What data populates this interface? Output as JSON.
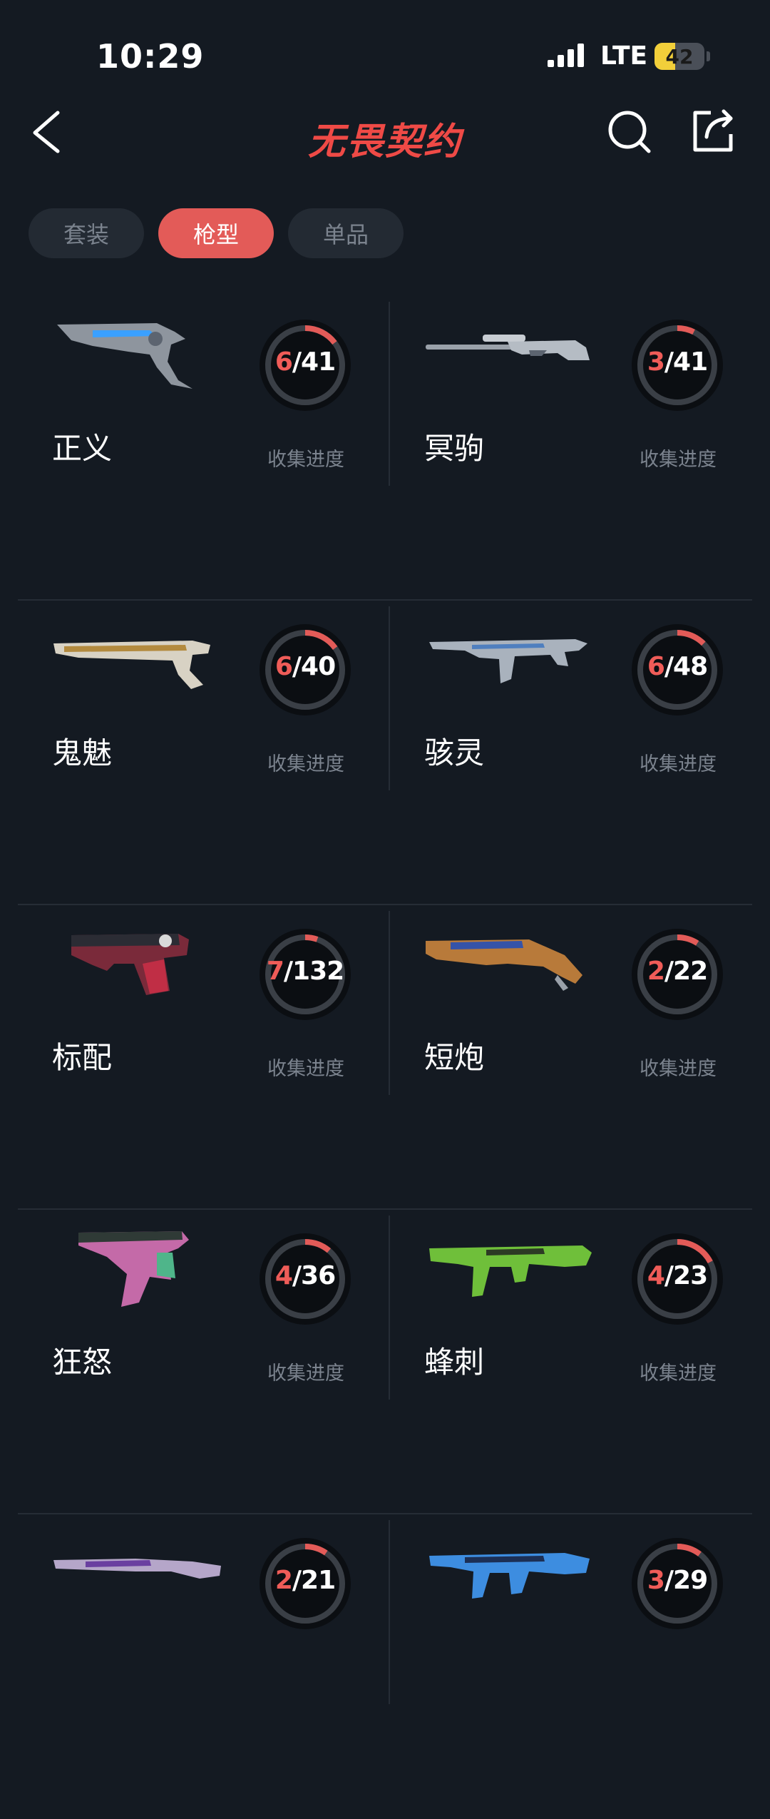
{
  "status_bar": {
    "time": "10:29",
    "network": "LTE",
    "battery": "42",
    "battery_level": 0.42
  },
  "nav": {
    "title": "无畏契约"
  },
  "tabs": [
    {
      "label": "套装",
      "active": false
    },
    {
      "label": "枪型",
      "active": true
    },
    {
      "label": "单品",
      "active": false
    }
  ],
  "progress_label": "收集进度",
  "colors": {
    "accent": "#e35b58",
    "ring_track": "#3a3f46",
    "background": "#141a22"
  },
  "weapons": [
    {
      "name": "正义",
      "owned": "6",
      "total": "41",
      "ratio": 0.1463,
      "icon": "sheriff-revolver-icon"
    },
    {
      "name": "冥驹",
      "owned": "3",
      "total": "41",
      "ratio": 0.0732,
      "icon": "operator-sniper-icon"
    },
    {
      "name": "鬼魅",
      "owned": "6",
      "total": "40",
      "ratio": 0.15,
      "icon": "ghost-pistol-icon"
    },
    {
      "name": "骇灵",
      "owned": "6",
      "total": "48",
      "ratio": 0.125,
      "icon": "spectre-smg-icon"
    },
    {
      "name": "标配",
      "owned": "7",
      "total": "132",
      "ratio": 0.053,
      "icon": "classic-pistol-icon"
    },
    {
      "name": "短炮",
      "owned": "2",
      "total": "22",
      "ratio": 0.0909,
      "icon": "shorty-shotgun-icon"
    },
    {
      "name": "狂怒",
      "owned": "4",
      "total": "36",
      "ratio": 0.1111,
      "icon": "frenzy-pistol-icon"
    },
    {
      "name": "蜂刺",
      "owned": "4",
      "total": "23",
      "ratio": 0.1739,
      "icon": "stinger-smg-icon"
    },
    {
      "name": "",
      "owned": "2",
      "total": "21",
      "ratio": 0.0952,
      "icon": "shotgun-icon"
    },
    {
      "name": "",
      "owned": "3",
      "total": "29",
      "ratio": 0.1034,
      "icon": "rifle-icon"
    }
  ]
}
